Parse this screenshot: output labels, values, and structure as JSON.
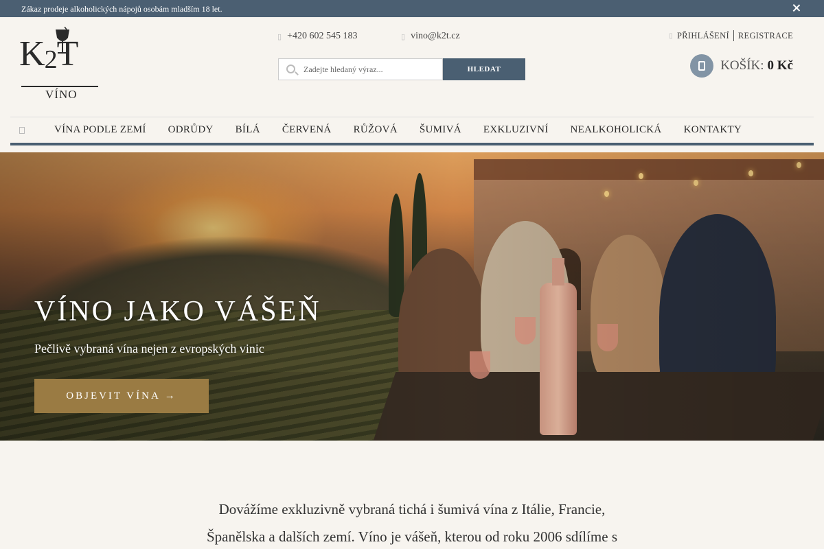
{
  "notice": {
    "text": "Zákaz prodeje alkoholických nápojů osobám mladším 18 let.",
    "close_icon": "close-icon"
  },
  "logo": {
    "mark_k": "K",
    "mark_2": "2",
    "mark_t": "T",
    "sub": "VÍNO",
    "icon": "wine-glass-icon"
  },
  "contact": {
    "phone": "+420 602 545 183",
    "phone_icon": "phone-icon",
    "email": "vino@k2t.cz",
    "email_icon": "mail-icon"
  },
  "search": {
    "placeholder": "Zadejte hledaný výraz...",
    "value": "",
    "button_label": "HLEDAT",
    "icon": "search-icon"
  },
  "account": {
    "icon": "user-icon",
    "login": "PŘIHLÁŠENÍ",
    "register": "REGISTRACE"
  },
  "cart": {
    "icon": "cart-icon",
    "label": "KOŠÍK:",
    "amount": "0 Kč"
  },
  "nav": {
    "home_icon": "home-icon",
    "items": [
      {
        "label": "VÍNA PODLE ZEMÍ"
      },
      {
        "label": "ODRŮDY"
      },
      {
        "label": "BÍLÁ"
      },
      {
        "label": "ČERVENÁ"
      },
      {
        "label": "RŮŽOVÁ"
      },
      {
        "label": "ŠUMIVÁ"
      },
      {
        "label": "EXKLUZIVNÍ"
      },
      {
        "label": "NEALKOHOLICKÁ"
      },
      {
        "label": "KONTAKTY"
      }
    ]
  },
  "hero": {
    "title": "VÍNO JAKO VÁŠEŇ",
    "lead": "Pečlivě vybraná vína nejen z evropských vinic",
    "cta_label": "OBJEVIT VÍNA →"
  },
  "intro": {
    "line1": "Dovážíme exkluzivně vybraná tichá i šumivá vína z Itálie, Francie,",
    "line2": "Španělska a dalších zemí. Víno je vášeň, kterou od roku 2006 sdílíme s"
  },
  "colors": {
    "accent": "#4a5f72",
    "cta": "#9a7b43",
    "background": "#f7f4ef"
  }
}
